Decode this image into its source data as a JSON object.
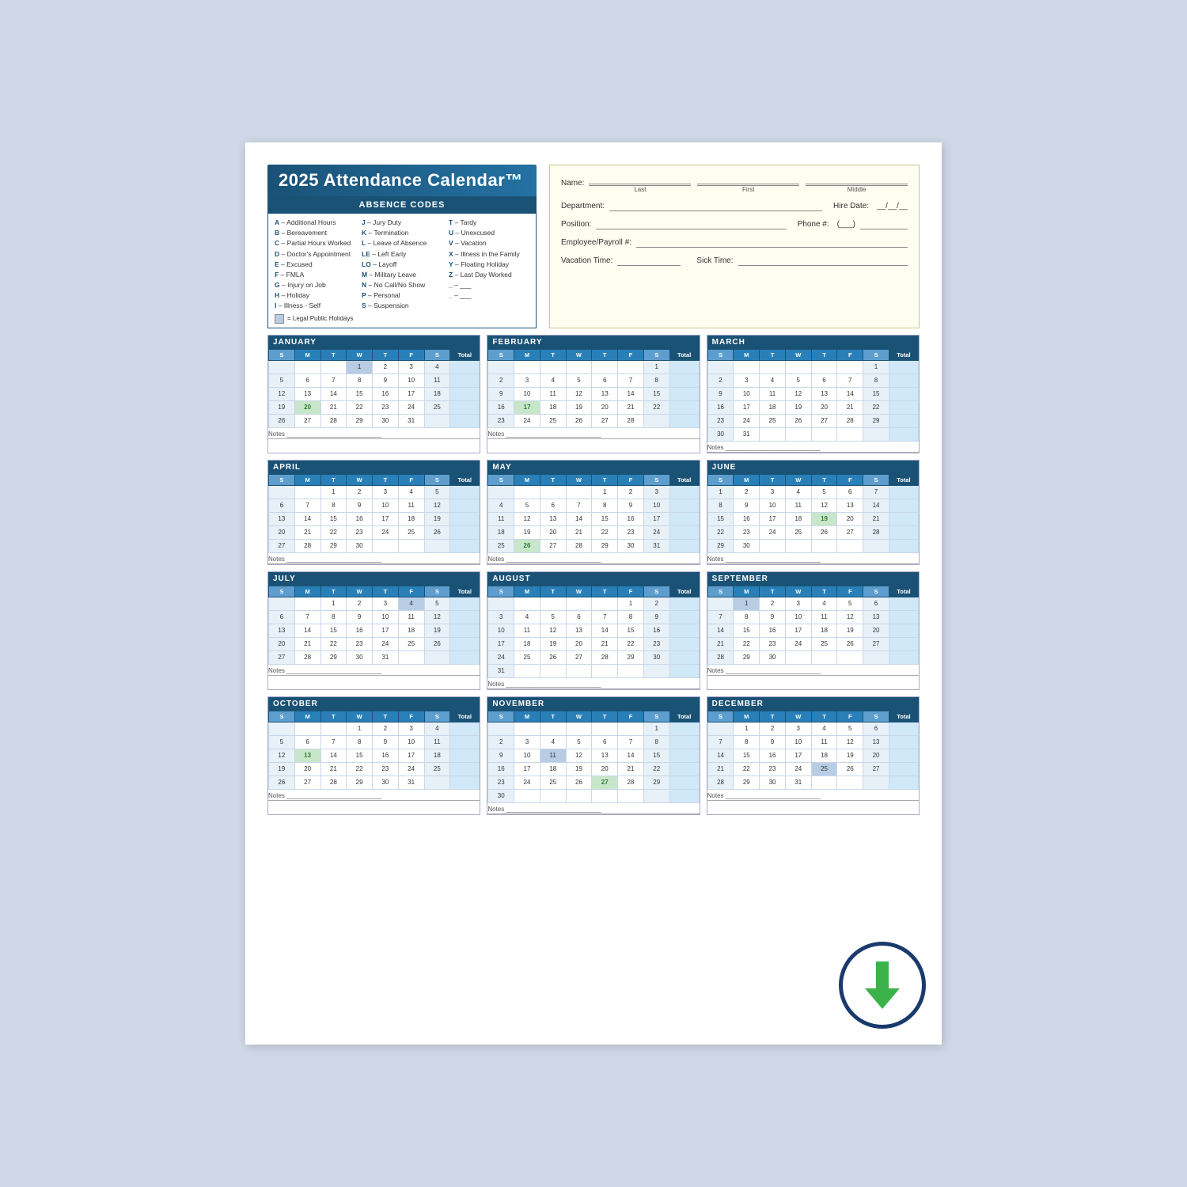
{
  "title": "2025 Attendance Calendar™",
  "absence_codes": {
    "header": "ABSENCE CODES",
    "col1": [
      {
        "code": "A",
        "desc": "Additional Hours"
      },
      {
        "code": "B",
        "desc": "Bereavement"
      },
      {
        "code": "C",
        "desc": "Partial Hours Worked"
      },
      {
        "code": "D",
        "desc": "Doctor's Appointment"
      },
      {
        "code": "E",
        "desc": "Excused"
      },
      {
        "code": "F",
        "desc": "FMLA"
      },
      {
        "code": "G",
        "desc": "Injury on Job"
      },
      {
        "code": "H",
        "desc": "Holiday"
      },
      {
        "code": "I",
        "desc": "Illness - Self"
      }
    ],
    "col2": [
      {
        "code": "J",
        "desc": "Jury Duty"
      },
      {
        "code": "K",
        "desc": "Termination"
      },
      {
        "code": "L",
        "desc": "Leave of Absence"
      },
      {
        "code": "LE",
        "desc": "Left Early"
      },
      {
        "code": "LO",
        "desc": "Layoff"
      },
      {
        "code": "M",
        "desc": "Military Leave"
      },
      {
        "code": "N",
        "desc": "No Call/No Show"
      },
      {
        "code": "P",
        "desc": "Personal"
      },
      {
        "code": "S",
        "desc": "Suspension"
      }
    ],
    "col3": [
      {
        "code": "T",
        "desc": "Tardy"
      },
      {
        "code": "U",
        "desc": "Unexcused"
      },
      {
        "code": "V",
        "desc": "Vacation"
      },
      {
        "code": "X",
        "desc": "Illness in the Family"
      },
      {
        "code": "Y",
        "desc": "Floating Holiday"
      },
      {
        "code": "Z",
        "desc": "Last Day Worked"
      }
    ],
    "legend": "= Legal Public Holidays"
  },
  "employee_fields": {
    "name_label": "Name:",
    "last_label": "Last",
    "first_label": "First",
    "middle_label": "Middle",
    "dept_label": "Department:",
    "hire_label": "Hire Date:",
    "position_label": "Position:",
    "phone_label": "Phone #:",
    "emp_label": "Employee/Payroll #:",
    "vacation_label": "Vacation Time:",
    "sick_label": "Sick Time:"
  },
  "months": [
    {
      "name": "JANUARY",
      "days": [
        [
          "",
          "",
          "",
          "1",
          "2",
          "3",
          "4",
          ""
        ],
        [
          "5",
          "6",
          "7",
          "8",
          "9",
          "10",
          "11",
          ""
        ],
        [
          "12",
          "13",
          "14",
          "15",
          "16",
          "17",
          "18",
          ""
        ],
        [
          "19",
          "20",
          "21",
          "22",
          "23",
          "24",
          "25",
          ""
        ],
        [
          "26",
          "27",
          "28",
          "29",
          "30",
          "31",
          "",
          ""
        ]
      ],
      "holidays": [
        "1"
      ],
      "highlights": [
        "20"
      ]
    },
    {
      "name": "FEBRUARY",
      "days": [
        [
          "",
          "",
          "",
          "",
          "",
          "",
          "1",
          ""
        ],
        [
          "2",
          "3",
          "4",
          "5",
          "6",
          "7",
          "8",
          ""
        ],
        [
          "9",
          "10",
          "11",
          "12",
          "13",
          "14",
          "15",
          ""
        ],
        [
          "16",
          "17",
          "18",
          "19",
          "20",
          "21",
          "22",
          ""
        ],
        [
          "23",
          "24",
          "25",
          "26",
          "27",
          "28",
          "",
          ""
        ]
      ],
      "holidays": [],
      "highlights": [
        "17"
      ]
    },
    {
      "name": "MARCH",
      "days": [
        [
          "",
          "",
          "",
          "",
          "",
          "",
          "1",
          ""
        ],
        [
          "2",
          "3",
          "4",
          "5",
          "6",
          "7",
          "8",
          ""
        ],
        [
          "9",
          "10",
          "11",
          "12",
          "13",
          "14",
          "15",
          ""
        ],
        [
          "16",
          "17",
          "18",
          "19",
          "20",
          "21",
          "22",
          ""
        ],
        [
          "23",
          "24",
          "25",
          "26",
          "27",
          "28",
          "29",
          ""
        ],
        [
          "30",
          "31",
          "",
          "",
          "",
          "",
          "",
          ""
        ]
      ],
      "holidays": [],
      "highlights": []
    },
    {
      "name": "APRIL",
      "days": [
        [
          "",
          "",
          "1",
          "2",
          "3",
          "4",
          "5",
          ""
        ],
        [
          "6",
          "7",
          "8",
          "9",
          "10",
          "11",
          "12",
          ""
        ],
        [
          "13",
          "14",
          "15",
          "16",
          "17",
          "18",
          "19",
          ""
        ],
        [
          "20",
          "21",
          "22",
          "23",
          "24",
          "25",
          "26",
          ""
        ],
        [
          "27",
          "28",
          "29",
          "30",
          "",
          "",
          "",
          ""
        ]
      ],
      "holidays": [],
      "highlights": []
    },
    {
      "name": "MAY",
      "days": [
        [
          "",
          "",
          "",
          "",
          "1",
          "2",
          "3",
          ""
        ],
        [
          "4",
          "5",
          "6",
          "7",
          "8",
          "9",
          "10",
          ""
        ],
        [
          "11",
          "12",
          "13",
          "14",
          "15",
          "16",
          "17",
          ""
        ],
        [
          "18",
          "19",
          "20",
          "21",
          "22",
          "23",
          "24",
          ""
        ],
        [
          "25",
          "26",
          "27",
          "28",
          "29",
          "30",
          "31",
          ""
        ]
      ],
      "holidays": [],
      "highlights": [
        "26"
      ]
    },
    {
      "name": "JUNE",
      "days": [
        [
          "1",
          "2",
          "3",
          "4",
          "5",
          "6",
          "7",
          ""
        ],
        [
          "8",
          "9",
          "10",
          "11",
          "12",
          "13",
          "14",
          ""
        ],
        [
          "15",
          "16",
          "17",
          "18",
          "19",
          "20",
          "21",
          ""
        ],
        [
          "22",
          "23",
          "24",
          "25",
          "26",
          "27",
          "28",
          ""
        ],
        [
          "29",
          "30",
          "",
          "",
          "",
          "",
          "",
          ""
        ]
      ],
      "holidays": [],
      "highlights": [
        "19"
      ]
    },
    {
      "name": "JULY",
      "days": [
        [
          "",
          "",
          "1",
          "2",
          "3",
          "4",
          "5",
          ""
        ],
        [
          "6",
          "7",
          "8",
          "9",
          "10",
          "11",
          "12",
          ""
        ],
        [
          "13",
          "14",
          "15",
          "16",
          "17",
          "18",
          "19",
          ""
        ],
        [
          "20",
          "21",
          "22",
          "23",
          "24",
          "25",
          "26",
          ""
        ],
        [
          "27",
          "28",
          "29",
          "30",
          "31",
          "",
          "",
          ""
        ]
      ],
      "holidays": [
        "4"
      ],
      "highlights": []
    },
    {
      "name": "AUGUST",
      "days": [
        [
          "",
          "",
          "",
          "",
          "",
          "1",
          "2",
          ""
        ],
        [
          "3",
          "4",
          "5",
          "6",
          "7",
          "8",
          "9",
          ""
        ],
        [
          "10",
          "11",
          "12",
          "13",
          "14",
          "15",
          "16",
          ""
        ],
        [
          "17",
          "18",
          "19",
          "20",
          "21",
          "22",
          "23",
          ""
        ],
        [
          "24",
          "25",
          "26",
          "27",
          "28",
          "29",
          "30",
          ""
        ],
        [
          "31",
          "",
          "",
          "",
          "",
          "",
          "",
          ""
        ]
      ],
      "holidays": [],
      "highlights": []
    },
    {
      "name": "SEPTEMBER",
      "days": [
        [
          "",
          "1",
          "2",
          "3",
          "4",
          "5",
          "6",
          ""
        ],
        [
          "7",
          "8",
          "9",
          "10",
          "11",
          "12",
          "13",
          ""
        ],
        [
          "14",
          "15",
          "16",
          "17",
          "18",
          "19",
          "20",
          ""
        ],
        [
          "21",
          "22",
          "23",
          "24",
          "25",
          "26",
          "27",
          ""
        ],
        [
          "28",
          "29",
          "30",
          "",
          "",
          "",
          "",
          ""
        ]
      ],
      "holidays": [
        "1"
      ],
      "highlights": []
    },
    {
      "name": "OCTOBER",
      "days": [
        [
          "",
          "",
          "",
          "1",
          "2",
          "3",
          "4",
          ""
        ],
        [
          "5",
          "6",
          "7",
          "8",
          "9",
          "10",
          "11",
          ""
        ],
        [
          "12",
          "13",
          "14",
          "15",
          "16",
          "17",
          "18",
          ""
        ],
        [
          "19",
          "20",
          "21",
          "22",
          "23",
          "24",
          "25",
          ""
        ],
        [
          "26",
          "27",
          "28",
          "29",
          "30",
          "31",
          "",
          ""
        ]
      ],
      "holidays": [],
      "highlights": [
        "13"
      ]
    },
    {
      "name": "NOVEMBER",
      "days": [
        [
          "",
          "",
          "",
          "",
          "",
          "",
          "1",
          ""
        ],
        [
          "2",
          "3",
          "4",
          "5",
          "6",
          "7",
          "8",
          ""
        ],
        [
          "9",
          "10",
          "11",
          "12",
          "13",
          "14",
          "15",
          ""
        ],
        [
          "16",
          "17",
          "18",
          "19",
          "20",
          "21",
          "22",
          ""
        ],
        [
          "23",
          "24",
          "25",
          "26",
          "27",
          "28",
          "29",
          ""
        ],
        [
          "30",
          "",
          "",
          "",
          "",
          "",
          "",
          ""
        ]
      ],
      "holidays": [
        "11",
        "27"
      ],
      "highlights": [
        "27"
      ]
    },
    {
      "name": "DECEMBER",
      "days": [
        [
          "",
          "1",
          "2",
          "3",
          "4",
          "5",
          "6",
          ""
        ],
        [
          "7",
          "8",
          "9",
          "10",
          "11",
          "12",
          "13",
          ""
        ],
        [
          "14",
          "15",
          "16",
          "17",
          "18",
          "19",
          "20",
          ""
        ],
        [
          "21",
          "22",
          "23",
          "24",
          "25",
          "26",
          "27",
          ""
        ],
        [
          "28",
          "29",
          "30",
          "31",
          "",
          "",
          "",
          ""
        ]
      ],
      "holidays": [
        "25"
      ],
      "highlights": []
    }
  ],
  "days_header": [
    "S",
    "M",
    "T",
    "W",
    "T",
    "F",
    "S",
    "Total"
  ],
  "notes_label": "Notes"
}
